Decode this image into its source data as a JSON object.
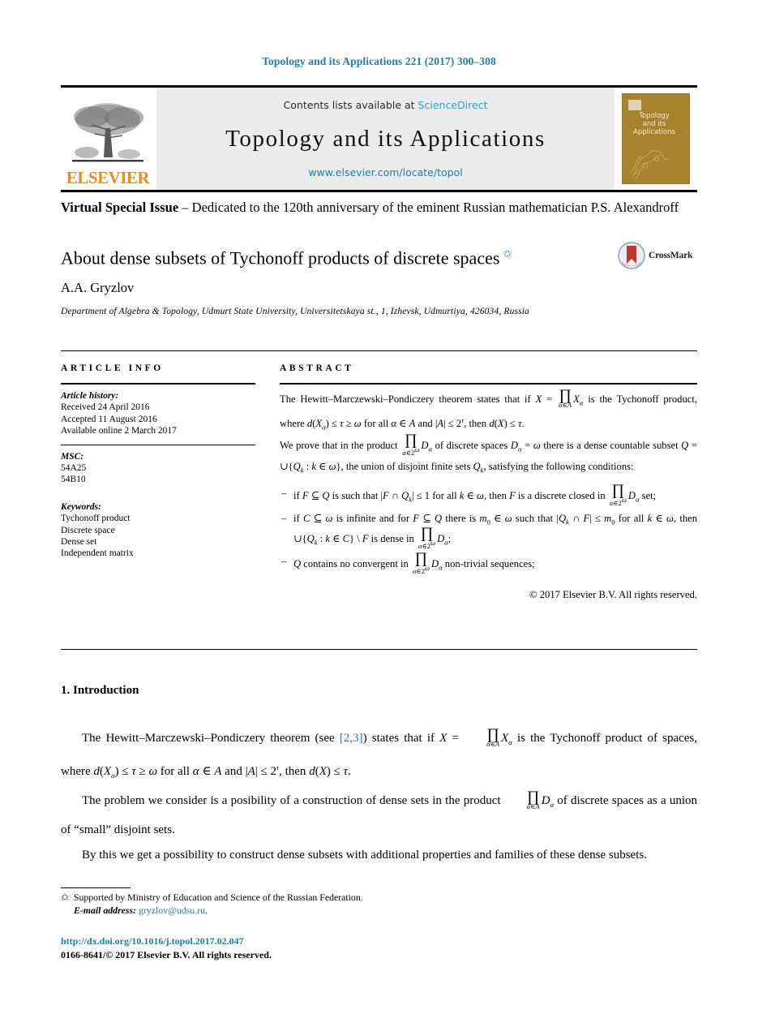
{
  "running_head": "Topology and its Applications 221 (2017) 300–308",
  "masthead": {
    "publisher_name": "ELSEVIER",
    "contents_prefix": "Contents lists available at",
    "sciencedirect_link": "ScienceDirect",
    "journal_name": "Topology and its Applications",
    "journal_url": "www.elsevier.com/locate/topol",
    "cover_title": "Topology\nand its\nApplications",
    "link_color": "#2b9fd4",
    "band_color": "#ebebeb",
    "cover_color": "#a8822d",
    "elsevier_orange": "#f08a1e"
  },
  "special_issue": {
    "bold_prefix": "Virtual Special Issue",
    "rest": " – Dedicated to the 120th anniversary of the eminent Russian mathematician P.S. Alexandroff"
  },
  "title": {
    "text": "About dense subsets of Tychonoff products of discrete spaces",
    "footnote_marker": "✩"
  },
  "crossmark": {
    "label": "CrossMark"
  },
  "author": "A.A. Gryzlov",
  "affiliation": "Department of Algebra & Topology, Udmurt State University, Universitetskaya st., 1, Izhevsk, Udmurtiya, 426034, Russia",
  "article_info": {
    "heading": "ARTICLE INFO",
    "history_label": "Article history:",
    "history": [
      "Received 24 April 2016",
      "Accepted 11 August 2016",
      "Available online 2 March 2017"
    ],
    "msc_label": "MSC:",
    "msc": [
      "54A25",
      "54B10"
    ],
    "keywords_label": "Keywords:",
    "keywords": [
      "Tychonoff product",
      "Discrete space",
      "Dense set",
      "Independent matrix"
    ]
  },
  "abstract": {
    "heading": "ABSTRACT",
    "para1_a": "The Hewitt–Marczewski–Pondiczery theorem states that if ",
    "para1_b": " is the Tychonoff product, where ",
    "para1_c": " for all ",
    "para1_d": " and ",
    "para1_e": ", then ",
    "para1_f": ".",
    "para2_a": "We prove that in the product ",
    "para2_b": " of discrete spaces ",
    "para2_c": " there is a dense countable subset ",
    "para2_d": ", the union of disjoint finite sets ",
    "para2_e": ", satisfying the following conditions:",
    "bullets": [
      {
        "a": "if ",
        "b": " is such that ",
        "c": " for all ",
        "d": ", then ",
        "e": " is a discrete closed in ",
        "f": " set;"
      },
      {
        "a": "if ",
        "b": " is infinite and for ",
        "c": " there is ",
        "d": " such that ",
        "e": " for all ",
        "f": ", then ",
        "g": " is dense in ",
        "h": ";"
      },
      {
        "a": "",
        "b": " contains no convergent in ",
        "c": " non-trivial sequences;"
      }
    ],
    "copyright": "© 2017 Elsevier B.V. All rights reserved."
  },
  "introduction": {
    "heading": "1. Introduction",
    "p1_a": "The Hewitt–Marczewski–Pondiczery theorem (see ",
    "p1_ref": "[2,3]",
    "p1_b": ") states that if ",
    "p1_c": " is the Tychonoff product of spaces, where ",
    "p1_d": " for all ",
    "p1_e": " and ",
    "p1_f": ", then ",
    "p1_g": ".",
    "p2_a": "The problem we consider is a posibility of a construction of dense sets in the product ",
    "p2_b": " of discrete spaces as a union of “small” disjoint sets.",
    "p3": "By this we get a possibility to construct dense subsets with additional properties and families of these dense subsets."
  },
  "footer": {
    "star": "✩",
    "support_note": "Supported by Ministry of Education and Science of the Russian Federation.",
    "email_label": "E-mail address:",
    "email": "gryzlov@udsu.ru",
    "email_period": ".",
    "doi": "http://dx.doi.org/10.1016/j.topol.2017.02.047",
    "issn_line": "0166-8641/© 2017 Elsevier B.V. All rights reserved."
  }
}
